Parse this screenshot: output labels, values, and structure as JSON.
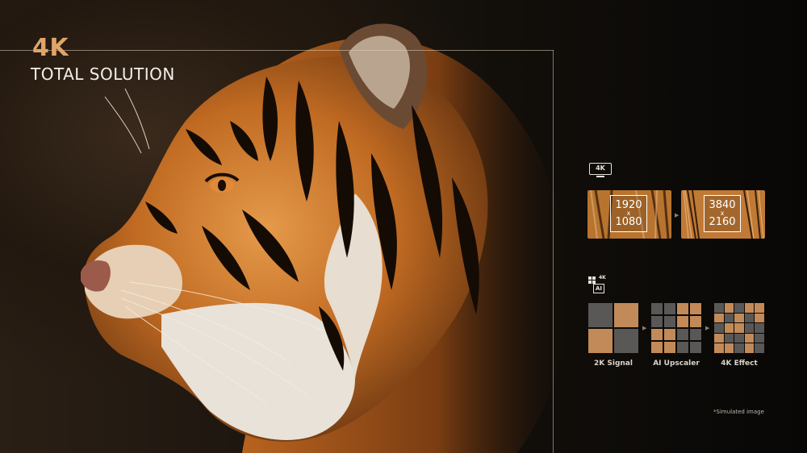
{
  "headline": {
    "title": "4K",
    "subtitle": "TOTAL SOLUTION"
  },
  "resolution": {
    "badge_icon": "monitor-4k-icon",
    "badge_text": "4K",
    "from": {
      "width": "1920",
      "x": "x",
      "height": "1080"
    },
    "to": {
      "width": "3840",
      "x": "x",
      "height": "2160"
    }
  },
  "upscale": {
    "badge_icon": "ai-4k-chip-icon",
    "badge_ai": "AI",
    "badge_4k": "4K",
    "steps": [
      {
        "label": "2K Signal"
      },
      {
        "label": "AI Upscaler"
      },
      {
        "label": "4K Effect"
      }
    ]
  },
  "footnote": "*Simulated image",
  "colors": {
    "accent": "#e0a56a",
    "tile_copper": "#c28a58",
    "tile_gray": "#595857",
    "background": "#0b0907"
  }
}
